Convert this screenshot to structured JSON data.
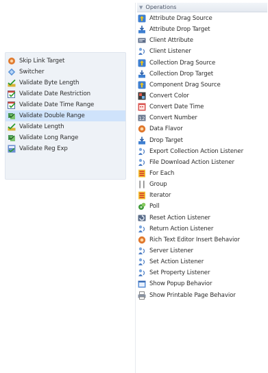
{
  "left_list": {
    "items": [
      {
        "label": "Skip Link Target",
        "icon": "skip-link-icon"
      },
      {
        "label": "Switcher",
        "icon": "switcher-icon"
      },
      {
        "label": "Validate Byte Length",
        "icon": "validate-length-icon"
      },
      {
        "label": "Validate Date Restriction",
        "icon": "validate-date-icon"
      },
      {
        "label": "Validate Date Time Range",
        "icon": "validate-date-icon"
      },
      {
        "label": "Validate Double Range",
        "icon": "validate-range-icon",
        "selected": true
      },
      {
        "label": "Validate Length",
        "icon": "validate-length-icon"
      },
      {
        "label": "Validate Long Range",
        "icon": "validate-range-icon"
      },
      {
        "label": "Validate Reg Exp",
        "icon": "validate-regexp-icon"
      }
    ]
  },
  "operations": {
    "header": "Operations",
    "items": [
      {
        "label": "Attribute Drag Source",
        "icon": "drag-source-icon"
      },
      {
        "label": "Attribute Drop Target",
        "icon": "drop-target-icon"
      },
      {
        "label": "Client Attribute",
        "icon": "client-attribute-icon"
      },
      {
        "label": "Client Listener",
        "icon": "listener-icon"
      },
      {
        "label": "Collection Drag Source",
        "icon": "drag-source-icon"
      },
      {
        "label": "Collection Drop Target",
        "icon": "drop-target-icon"
      },
      {
        "label": "Component Drag Source",
        "icon": "drag-source-icon"
      },
      {
        "label": "Convert Color",
        "icon": "convert-color-icon"
      },
      {
        "label": "Convert Date Time",
        "icon": "convert-date-icon"
      },
      {
        "label": "Convert Number",
        "icon": "convert-number-icon"
      },
      {
        "label": "Data Flavor",
        "icon": "data-flavor-icon"
      },
      {
        "label": "Drop Target",
        "icon": "drop-target-icon"
      },
      {
        "label": "Export Collection Action Listener",
        "icon": "listener-icon"
      },
      {
        "label": "File Download Action Listener",
        "icon": "listener-icon"
      },
      {
        "label": "For Each",
        "icon": "for-each-icon"
      },
      {
        "label": "Group",
        "icon": "group-icon"
      },
      {
        "label": "Iterator",
        "icon": "iterator-icon"
      },
      {
        "label": "Poll",
        "icon": "poll-icon"
      },
      {
        "label": "Reset Action Listener",
        "icon": "reset-listener-icon"
      },
      {
        "label": "Return Action Listener",
        "icon": "listener-icon"
      },
      {
        "label": "Rich Text Editor Insert Behavior",
        "icon": "behavior-icon"
      },
      {
        "label": "Server Listener",
        "icon": "listener-icon"
      },
      {
        "label": "Set Action Listener",
        "icon": "listener-icon"
      },
      {
        "label": "Set Property Listener",
        "icon": "listener-icon"
      },
      {
        "label": "Show Popup Behavior",
        "icon": "popup-behavior-icon"
      },
      {
        "label": "Show Printable Page Behavior",
        "icon": "printable-page-icon"
      }
    ]
  }
}
